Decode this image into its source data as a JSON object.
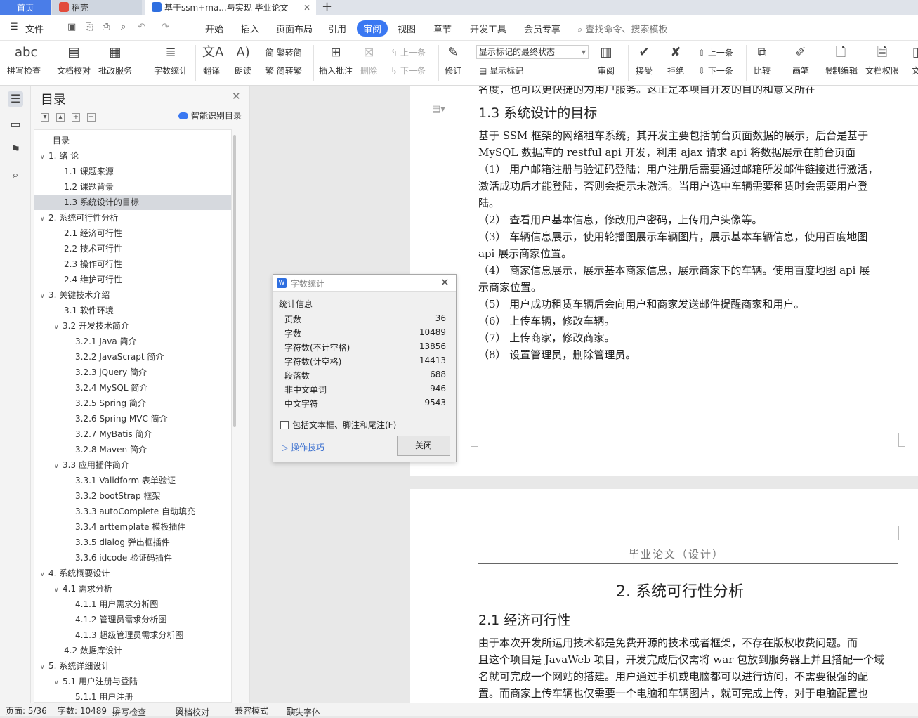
{
  "tabs": {
    "home": "首页",
    "wps": "稻壳",
    "doc": "基于ssm+ma...与实现 毕业论文",
    "add": "+"
  },
  "menu": {
    "file": "文件",
    "items": [
      "开始",
      "插入",
      "页面布局",
      "引用",
      "审阅",
      "视图",
      "章节",
      "开发工具",
      "会员专享"
    ],
    "search": "查找命令、搜索模板"
  },
  "ribbon": {
    "spell": "拼写检查",
    "proof": "文档校对",
    "annot": "批改服务",
    "wordcount": "字数统计",
    "translate": "翻译",
    "read": "朗读",
    "trad": "繁转简",
    "simp": "简转繁",
    "insert_comment": "插入批注",
    "delete": "删除",
    "prev": "上一条",
    "next": "下一条",
    "revise": "修订",
    "markup_state": "显示标记的最终状态",
    "show_markup": "显示标记",
    "review": "审阅",
    "accept": "接受",
    "reject": "拒绝",
    "prev2": "上一条",
    "next2": "下一条",
    "compare": "比较",
    "pen": "画笔",
    "restrict": "限制编辑",
    "perm": "文档权限",
    "more": "文"
  },
  "toc": {
    "title": "目录",
    "smart": "智能识别目录",
    "items": [
      {
        "label": "目录",
        "indent": 0,
        "arrow": ""
      },
      {
        "label": "1.  绪  论",
        "indent": 0,
        "arrow": "v"
      },
      {
        "label": "1.1  课题来源",
        "indent": 1,
        "arrow": ""
      },
      {
        "label": "1.2  课题背景",
        "indent": 1,
        "arrow": ""
      },
      {
        "label": "1.3  系统设计的目标",
        "indent": 1,
        "arrow": "",
        "selected": true
      },
      {
        "label": "2.  系统可行性分析",
        "indent": 0,
        "arrow": "v"
      },
      {
        "label": "2.1  经济可行性",
        "indent": 1,
        "arrow": ""
      },
      {
        "label": "2.2  技术可行性",
        "indent": 1,
        "arrow": ""
      },
      {
        "label": "2.3  操作可行性",
        "indent": 1,
        "arrow": ""
      },
      {
        "label": "2.4  维护可行性",
        "indent": 1,
        "arrow": ""
      },
      {
        "label": "3.  关键技术介绍",
        "indent": 0,
        "arrow": "v"
      },
      {
        "label": "3.1  软件环境",
        "indent": 1,
        "arrow": ""
      },
      {
        "label": "3.2  开发技术简介",
        "indent": 1,
        "arrow": "v"
      },
      {
        "label": "3.2.1 Java 简介",
        "indent": 2,
        "arrow": ""
      },
      {
        "label": "3.2.2 JavaScrapt 简介",
        "indent": 2,
        "arrow": ""
      },
      {
        "label": "3.2.3 jQuery 简介",
        "indent": 2,
        "arrow": ""
      },
      {
        "label": "3.2.4 MySQL 简介",
        "indent": 2,
        "arrow": ""
      },
      {
        "label": "3.2.5 Spring 简介",
        "indent": 2,
        "arrow": ""
      },
      {
        "label": "3.2.6 Spring MVC 简介",
        "indent": 2,
        "arrow": ""
      },
      {
        "label": "3.2.7 MyBatis  简介",
        "indent": 2,
        "arrow": ""
      },
      {
        "label": "3.2.8 Maven 简介",
        "indent": 2,
        "arrow": ""
      },
      {
        "label": "3.3  应用插件简介",
        "indent": 1,
        "arrow": "v"
      },
      {
        "label": "3.3.1 Validform 表单验证",
        "indent": 2,
        "arrow": ""
      },
      {
        "label": "3.3.2 bootStrap 框架",
        "indent": 2,
        "arrow": ""
      },
      {
        "label": "3.3.3 autoComplete 自动填充",
        "indent": 2,
        "arrow": ""
      },
      {
        "label": "3.3.4 arttemplate  模板插件",
        "indent": 2,
        "arrow": ""
      },
      {
        "label": "3.3.5 dialog  弹出框插件",
        "indent": 2,
        "arrow": ""
      },
      {
        "label": "3.3.6 idcode  验证码插件",
        "indent": 2,
        "arrow": ""
      },
      {
        "label": "4.  系统概要设计",
        "indent": 0,
        "arrow": "v"
      },
      {
        "label": "4.1  需求分析",
        "indent": 1,
        "arrow": "v"
      },
      {
        "label": "4.1.1  用户需求分析图",
        "indent": 2,
        "arrow": ""
      },
      {
        "label": "4.1.2  管理员需求分析图",
        "indent": 2,
        "arrow": ""
      },
      {
        "label": "4.1.3  超级管理员需求分析图",
        "indent": 2,
        "arrow": ""
      },
      {
        "label": "4.2  数据库设计",
        "indent": 1,
        "arrow": ""
      },
      {
        "label": "5.  系统详细设计",
        "indent": 0,
        "arrow": "v"
      },
      {
        "label": "5.1  用户注册与登陆",
        "indent": 1,
        "arrow": "v"
      },
      {
        "label": "5.1.1  用户注册",
        "indent": 2,
        "arrow": ""
      }
    ]
  },
  "doc": {
    "cut_line": "名度，也可以更快捷的为用户服务。这正是本项目开发的目的和意义所在",
    "h13": "1.3   系统设计的目标",
    "p1a": "    基于 SSM 框架的网络租车系统，其开发主要包括前台页面数据的展示，后台是基于",
    "p1b": "MySQL 数据库的 restful  api 开发，利用 ajax 请求 api 将数据展示在前台页面",
    "item1a": "（1） 用户邮箱注册与验证码登陆：用户注册后需要通过邮箱所发邮件链接进行激活，",
    "item1b": "激活成功后才能登陆，否则会提示未激活。当用户选中车辆需要租赁时会需要用户登",
    "item1c": "陆。",
    "item2": "（2） 查看用户基本信息，修改用户密码，上传用户头像等。",
    "item3a": "（3） 车辆信息展示，使用轮播图展示车辆图片，展示基本车辆信息，使用百度地图",
    "item3b": "api 展示商家位置。",
    "item4a": "（4）  商家信息展示，展示基本商家信息，展示商家下的车辆。使用百度地图 api 展",
    "item4b": "示商家位置。",
    "item5": "（5） 用户成功租赁车辆后会向用户和商家发送邮件提醒商家和用户。",
    "item6": "（6） 上传车辆，修改车辆。",
    "item7": "（7） 上传商家，修改商家。",
    "item8": "（8） 设置管理员，删除管理员。",
    "header2": "毕业论文（设计）",
    "h2": "2.  系统可行性分析",
    "h21": "2.1  经济可行性",
    "p2a": "    由于本次开发所运用技术都是免费开源的技术或者框架，不存在版权收费问题。而",
    "p2b": "且这个项目是 JavaWeb 项目，开发完成后仅需将 war 包放到服务器上并且搭配一个域",
    "p2c": "名就可完成一个网站的搭建。用户通过手机或电脑都可以进行访问，不需要很强的配",
    "p2d": "置。而商家上传车辆也仅需要一个电脑和车辆图片，就可完成上传，对于电脑配置也"
  },
  "dialog": {
    "title": "字数统计",
    "section": "统计信息",
    "rows": [
      {
        "k": "页数",
        "v": "36"
      },
      {
        "k": "字数",
        "v": "10489"
      },
      {
        "k": "字符数(不计空格)",
        "v": "13856"
      },
      {
        "k": "字符数(计空格)",
        "v": "14413"
      },
      {
        "k": "段落数",
        "v": "688"
      },
      {
        "k": "非中文单词",
        "v": "946"
      },
      {
        "k": "中文字符",
        "v": "9543"
      }
    ],
    "checkbox": "包括文本框、脚注和尾注(F)",
    "tips": "操作技巧",
    "close": "关闭"
  },
  "status": {
    "page": "页面: 5/36",
    "words": "字数: 10489",
    "spell": "拼写检查",
    "proof": "文档校对",
    "compat": "兼容模式",
    "font": "缺失字体"
  }
}
